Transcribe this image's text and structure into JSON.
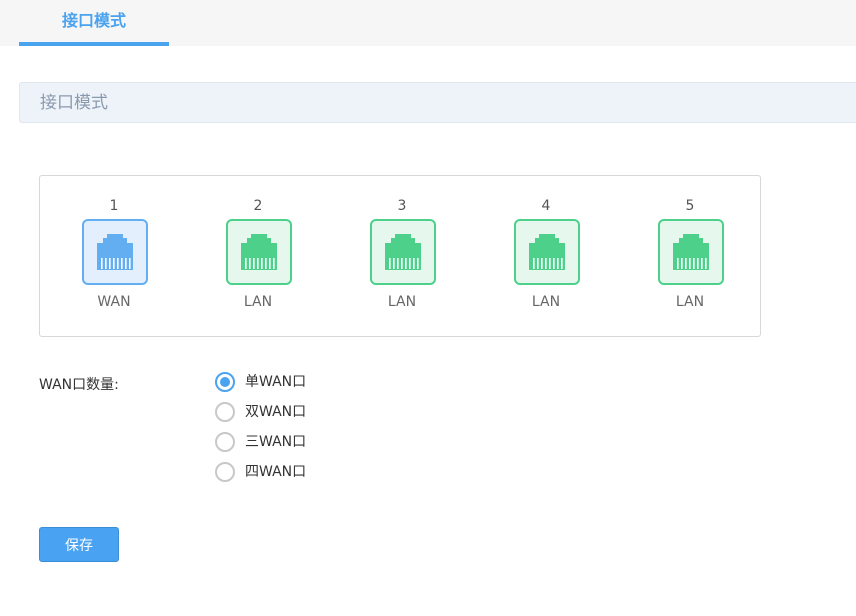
{
  "tabs": [
    {
      "label": "接口模式",
      "active": true
    }
  ],
  "section": {
    "title": "接口模式"
  },
  "ports": [
    {
      "number": "1",
      "type": "WAN",
      "color": "#62aef0"
    },
    {
      "number": "2",
      "type": "LAN",
      "color": "#4dd08a"
    },
    {
      "number": "3",
      "type": "LAN",
      "color": "#4dd08a"
    },
    {
      "number": "4",
      "type": "LAN",
      "color": "#4dd08a"
    },
    {
      "number": "5",
      "type": "LAN",
      "color": "#4dd08a"
    }
  ],
  "wan_count": {
    "label": "WAN口数量:",
    "options": [
      {
        "label": "单WAN口",
        "checked": true
      },
      {
        "label": "双WAN口",
        "checked": false
      },
      {
        "label": "三WAN口",
        "checked": false
      },
      {
        "label": "四WAN口",
        "checked": false
      }
    ]
  },
  "buttons": {
    "save": "保存"
  },
  "colors": {
    "accent": "#4aa3ef",
    "wan": "#62aef0",
    "lan": "#4dd08a"
  },
  "icons": {
    "port": "ethernet-port-icon"
  }
}
